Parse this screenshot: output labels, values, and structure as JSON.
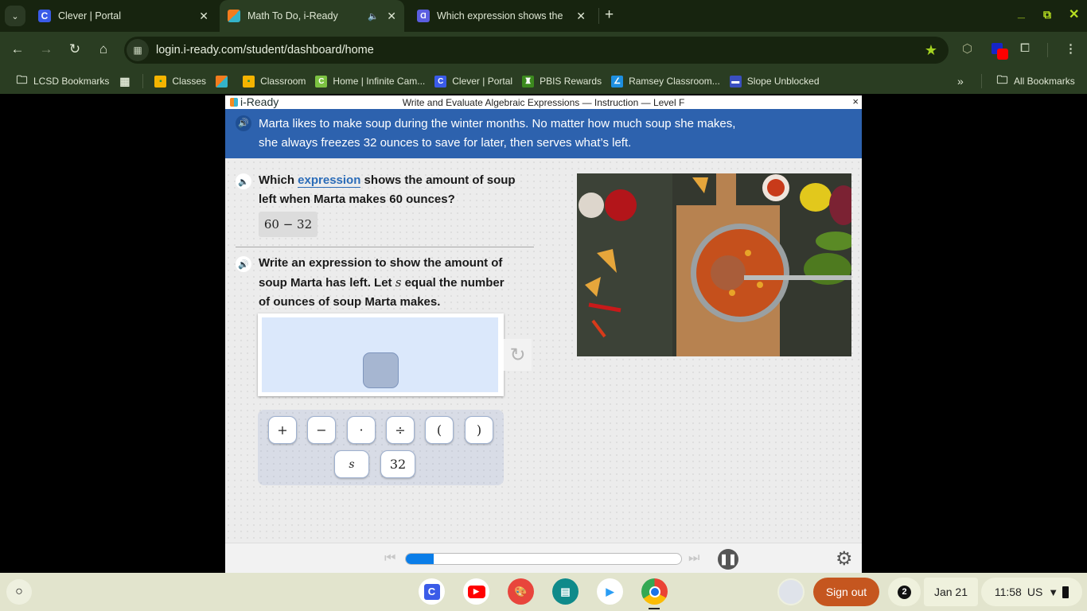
{
  "browser": {
    "tabs": [
      {
        "title": "Clever | Portal",
        "icon": "clever-icon",
        "active": false
      },
      {
        "title": "Math To Do, i-Ready",
        "icon": "iready-icon",
        "active": true,
        "audio": true
      },
      {
        "title": "Which expression shows the ar",
        "icon": "quiz-icon",
        "active": false
      }
    ],
    "url": "login.i-ready.com/student/dashboard/home",
    "bookmarks": [
      {
        "label": "LCSD Bookmarks",
        "icon": "folder-managed-icon"
      },
      {
        "label": "",
        "icon": "apps-grid-icon"
      },
      {
        "label": "Classes",
        "icon": "google-classroom-icon"
      },
      {
        "label": "",
        "icon": "iready-icon"
      },
      {
        "label": "Classroom",
        "icon": "google-classroom-icon"
      },
      {
        "label": "Home | Infinite Cam...",
        "icon": "infinite-campus-icon"
      },
      {
        "label": "Clever | Portal",
        "icon": "clever-icon"
      },
      {
        "label": "PBIS Rewards",
        "icon": "pbis-icon"
      },
      {
        "label": "Ramsey Classroom...",
        "icon": "ramsey-icon"
      },
      {
        "label": "Slope Unblocked",
        "icon": "slope-icon"
      }
    ],
    "all_bookmarks": "All Bookmarks",
    "overflow": "»"
  },
  "lesson": {
    "logo": "i-Ready",
    "title": "Write and Evaluate Algebraic Expressions — Instruction — Level F",
    "close": "×",
    "banner": [
      "Marta likes to make soup during the winter months. No matter how much soup she makes,",
      "she always freezes 32 ounces to save for later, then serves what’s left."
    ],
    "q1": {
      "before": "Which ",
      "term": "expression",
      "after": " shows the amount of soup",
      "line2": "left when Marta makes 60 ounces?",
      "answer": "60 − 32"
    },
    "q2": {
      "line1": "Write an expression to show the amount of",
      "line2a": "soup Marta has left. Let ",
      "var": "s",
      "line2b": " equal the number",
      "line3": "of ounces of soup Marta makes."
    },
    "keys_row1": [
      "+",
      "−",
      "·",
      "÷",
      "(",
      ")"
    ],
    "keys_row2": [
      "s",
      "32"
    ],
    "image_alt": "Pot of bean soup on a cutting board surrounded by vegetables",
    "progress": 0.1
  },
  "shelf": {
    "launcher": "○",
    "apps": [
      "Clever",
      "YouTube",
      "Canvas",
      "Classroom screen",
      "Play Store",
      "Chrome"
    ],
    "sign_out": "Sign out",
    "notifications": "2",
    "date": "Jan 21",
    "time": "11:58",
    "locale": "US"
  }
}
